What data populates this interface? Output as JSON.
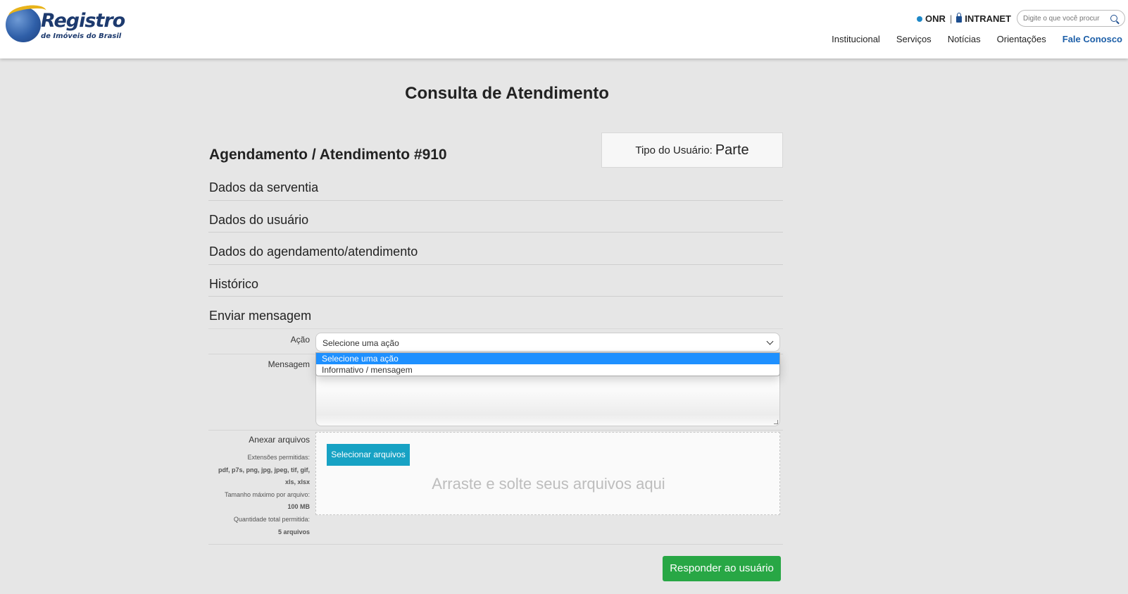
{
  "header": {
    "logo_title": "Registro",
    "logo_subtitle": "de Imóveis do Brasil",
    "onr_link": "ONR",
    "separator": "|",
    "intranet_link": "INTRANET",
    "search_placeholder": "Digite o que você procur",
    "nav": [
      "Institucional",
      "Serviços",
      "Notícias",
      "Orientações",
      "Fale Conosco"
    ]
  },
  "page": {
    "title": "Consulta de Atendimento",
    "attendance_title": "Agendamento / Atendimento #910",
    "user_type_label": "Tipo do Usuário:",
    "user_type_value": "Parte"
  },
  "sections": [
    "Dados da serventia",
    "Dados do usuário",
    "Dados do agendamento/atendimento",
    "Histórico",
    "Enviar mensagem"
  ],
  "form": {
    "action_label": "Ação",
    "action_selected": "Selecione uma ação",
    "action_options": [
      "Selecione uma ação",
      "Informativo / mensagem"
    ],
    "message_label": "Mensagem",
    "attach_label": "Anexar arquivos",
    "extensions_label": "Extensões permitidas:",
    "extensions_line1": "pdf, p7s, png, jpg, jpeg, tif, gif,",
    "extensions_line2": "xls, xlsx",
    "max_size_label": "Tamanho máximo por arquivo:",
    "max_size_value": "100 MB",
    "total_label": "Quantidade total permitida:",
    "total_value": "5 arquivos",
    "select_files_button": "Selecionar arquivos",
    "drop_text": "Arraste e solte seus arquivos aqui",
    "submit_button": "Responder ao usuário"
  },
  "colors": {
    "page_bg": "#e6e6e6",
    "brand_blue": "#1d3a6e",
    "file_button": "#17a2c4",
    "submit_button": "#28a745",
    "option_highlight": "#1e90ff"
  }
}
